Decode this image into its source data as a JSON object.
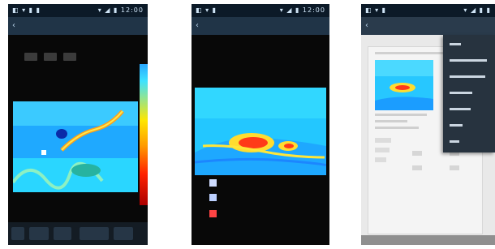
{
  "screens": [
    {
      "statusbar": {
        "left": "◧ ▾ ▮ ▮",
        "right": "▾ ◢ ▮ 12:00"
      },
      "appbar": {
        "back": "‹",
        "title": ""
      },
      "side_scale": true
    },
    {
      "statusbar": {
        "left": "◧ ▾ ▮",
        "right": "▾ ◢ ▮ 12:00"
      },
      "appbar": {
        "back": "‹",
        "title": ""
      },
      "legend": [
        {
          "label": "",
          "color": "#cfdcff"
        },
        {
          "label": "",
          "color": "#bcd0ff"
        },
        {
          "label": "",
          "color": "#ff4444"
        }
      ]
    },
    {
      "statusbar": {
        "left": "◧ ▾ ▮",
        "right": "▾ ◢ ▮ ▮"
      },
      "appbar": {
        "back": "‹",
        "title": ""
      },
      "menu": {
        "items": [
          "",
          "",
          "",
          "",
          "",
          "",
          ""
        ]
      }
    }
  ],
  "colors": {
    "status_bar": "#0c1a28",
    "app_bar": "#203447",
    "menu_bg": "#27333f",
    "page_bg": "#ffffff"
  },
  "icons": [
    "back-arrow-icon",
    "signal-icon",
    "battery-icon",
    "wifi-icon"
  ]
}
